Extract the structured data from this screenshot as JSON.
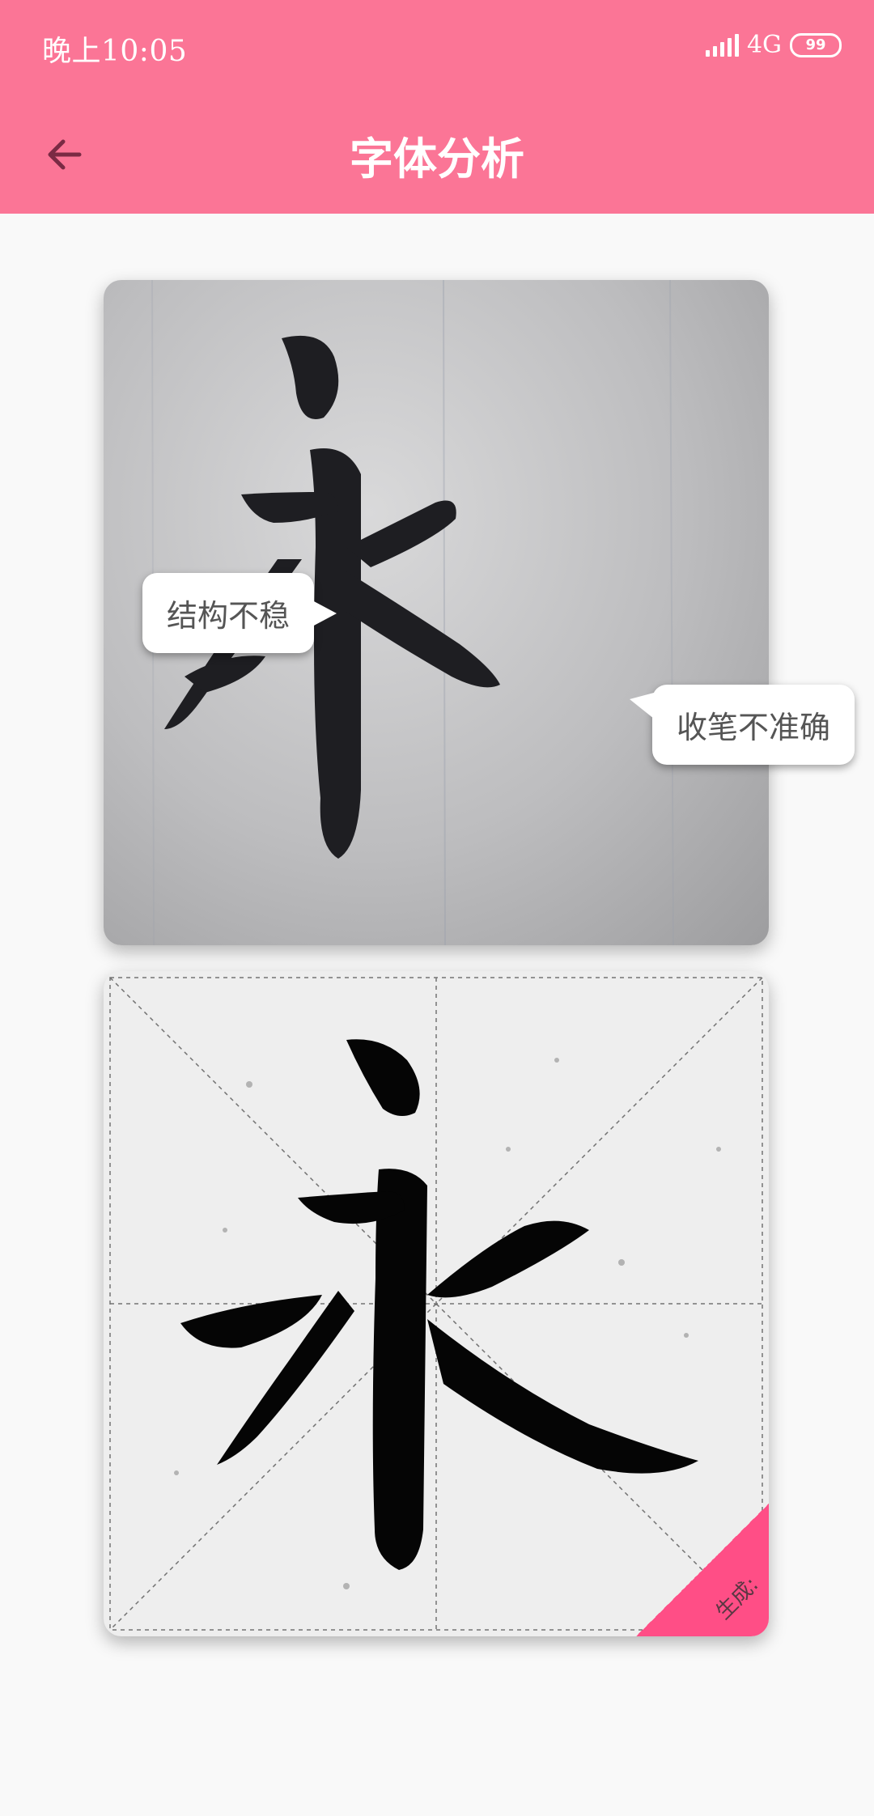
{
  "status_bar": {
    "time": "晚上10:05",
    "network": "4G",
    "battery": "99"
  },
  "app_bar": {
    "title": "字体分析"
  },
  "analysis": {
    "photo_character": "永",
    "labels": {
      "structure_issue": "结构不稳",
      "stroke_issue": "收笔不准确"
    }
  },
  "reference": {
    "character": "永",
    "corner_label": "生成:"
  },
  "colors": {
    "brand": "#fb7596",
    "corner": "#ff4e86"
  }
}
